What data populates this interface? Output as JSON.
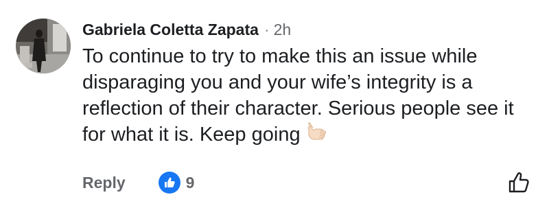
{
  "comment": {
    "author": "Gabriela Coletta Zapata",
    "separator": "·",
    "time": "2h",
    "text": "To continue to try to make this an issue while disparaging you and your wife’s integrity is a reflection of their character. Serious people see it for what it is. Keep going",
    "emoji": "call-me-hand-emoji"
  },
  "actions": {
    "reply_label": "Reply",
    "reaction_icon": "like-reaction-icon",
    "reaction_count": "9",
    "like_icon": "thumbs-up-outline-icon",
    "reaction_color": "#1877f2"
  }
}
